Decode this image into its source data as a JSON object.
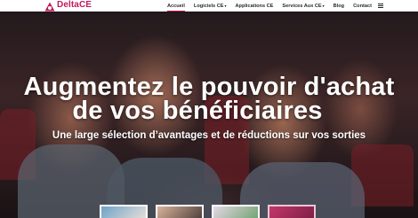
{
  "header": {
    "brand": "DeltaCE",
    "brand_color": "#c2185b",
    "nav": [
      {
        "label": "Accueil",
        "active": true
      },
      {
        "label": "Logiciels CE",
        "caret": true
      },
      {
        "label": "Applications CE"
      },
      {
        "label": "Services Aux CE",
        "caret": true
      },
      {
        "label": "Blog"
      },
      {
        "label": "Contact"
      }
    ],
    "menu_icon": "menu-icon"
  },
  "hero": {
    "title_line1": "Augmentez le pouvoir d'achat",
    "title_line2": "de vos bénéficiaires",
    "subtitle": "Une large sélection d’avantages et de réductions sur vos sorties"
  }
}
